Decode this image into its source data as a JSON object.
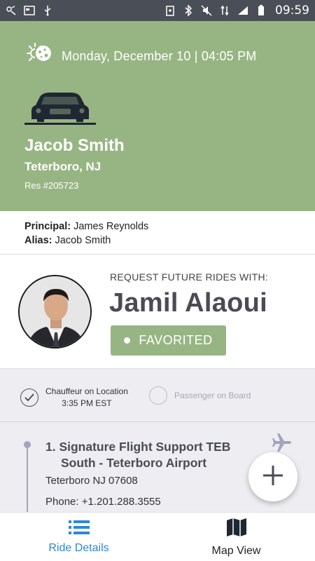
{
  "status_bar": {
    "time": "09:59"
  },
  "header": {
    "datetime": "Monday, December 10 | 04:05 PM",
    "passenger_name": "Jacob Smith",
    "location": "Teterboro, NJ",
    "reservation": "Res #205723"
  },
  "principal": {
    "principal_label": "Principal:",
    "principal_value": "James Reynolds",
    "alias_label": "Alias:",
    "alias_value": "Jacob Smith"
  },
  "chauffeur": {
    "request_label": "REQUEST FUTURE RIDES WITH:",
    "name": "Jamil Alaoui",
    "favorited_label": "FAVORITED"
  },
  "steps": {
    "step1_line1": "Chauffeur on Location",
    "step1_line2": "3:35 PM EST",
    "step2": "Passenger on Board"
  },
  "stop": {
    "title_line1": "1. Signature Flight Support TEB",
    "title_line2": "South - Teterboro Airport",
    "address": "Teterboro NJ 07608",
    "phone": "Phone: +1.201.288.3555"
  },
  "bottom_nav": {
    "ride_details": "Ride Details",
    "map_view": "Map View"
  },
  "colors": {
    "accent_green": "#97b583",
    "active_blue": "#2f86d8",
    "timeline": "#a3a3c0"
  },
  "icons": [
    "weather-icon",
    "car-icon",
    "check-circle-icon",
    "plane-icon",
    "plus-icon",
    "list-icon",
    "map-icon"
  ]
}
